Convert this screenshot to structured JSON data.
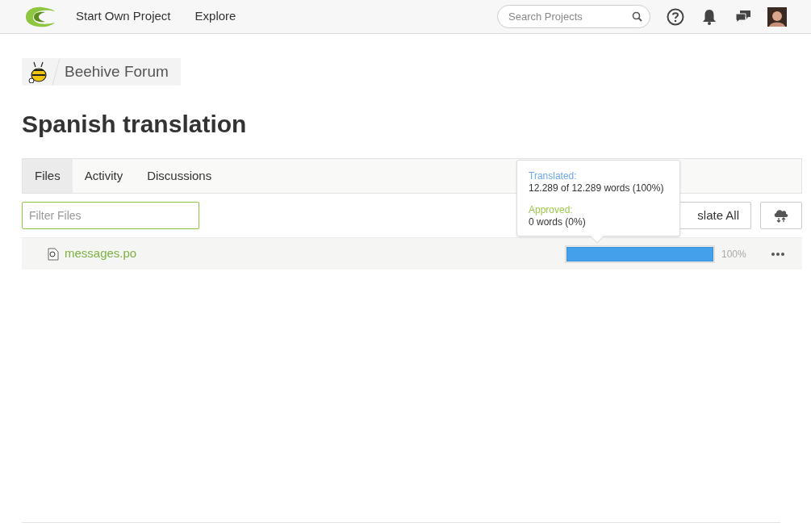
{
  "nav": {
    "links": [
      "Start Own Project",
      "Explore"
    ],
    "search": {
      "placeholder": "Search Projects"
    }
  },
  "breadcrumb": {
    "project": "Beehive Forum"
  },
  "title": "Spanish translation",
  "tabs": [
    {
      "label": "Files",
      "selected": true
    },
    {
      "label": "Activity",
      "selected": false
    },
    {
      "label": "Discussions",
      "selected": false
    }
  ],
  "filter": {
    "placeholder": "Filter Files"
  },
  "translate_all_button": "slate All",
  "files": [
    {
      "name": "messages.po",
      "level": 1,
      "percent": "100%"
    }
  ],
  "tooltip": {
    "translated_label": "Translated:",
    "translated_value": "12.289 of 12.289 words (100%)",
    "approved_label": "Approved:",
    "approved_value": "0 words (0%)"
  }
}
